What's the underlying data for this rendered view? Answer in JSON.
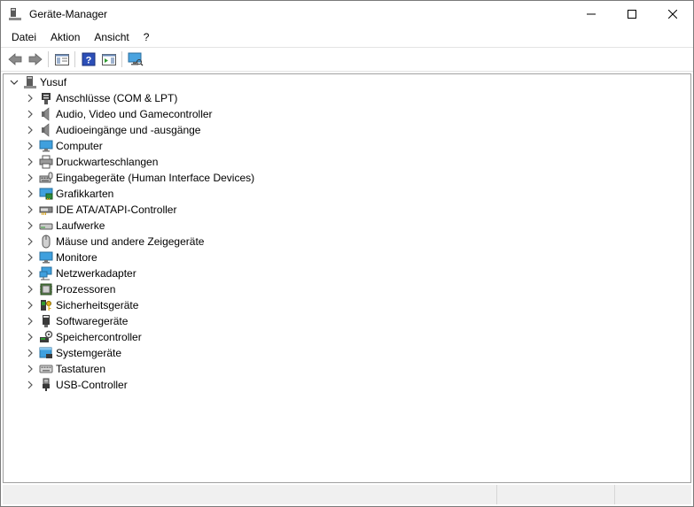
{
  "window": {
    "title": "Geräte-Manager"
  },
  "menu": [
    "Datei",
    "Aktion",
    "Ansicht",
    "?"
  ],
  "toolbar": [
    {
      "name": "back-button",
      "icon": "arrow-left-icon"
    },
    {
      "name": "forward-button",
      "icon": "arrow-right-icon"
    },
    {
      "name": "show-hide-console-tree-button",
      "icon": "console-tree-icon"
    },
    {
      "name": "help-button",
      "icon": "help-icon"
    },
    {
      "name": "action-pane-button",
      "icon": "action-pane-icon"
    },
    {
      "name": "scan-hardware-button",
      "icon": "monitor-scan-icon"
    }
  ],
  "tree": {
    "root": {
      "label": "Yusuf",
      "icon": "computer-tower-icon"
    },
    "categories": [
      {
        "label": "Anschlüsse (COM & LPT)",
        "icon": "port-icon"
      },
      {
        "label": "Audio, Video und Gamecontroller",
        "icon": "speaker-icon"
      },
      {
        "label": "Audioeingänge und -ausgänge",
        "icon": "speaker-icon"
      },
      {
        "label": "Computer",
        "icon": "monitor-icon"
      },
      {
        "label": "Druckwarteschlangen",
        "icon": "printer-icon"
      },
      {
        "label": "Eingabegeräte (Human Interface Devices)",
        "icon": "hid-icon"
      },
      {
        "label": "Grafikkarten",
        "icon": "display-adapter-icon"
      },
      {
        "label": "IDE ATA/ATAPI-Controller",
        "icon": "ide-controller-icon"
      },
      {
        "label": "Laufwerke",
        "icon": "drive-icon"
      },
      {
        "label": "Mäuse und andere Zeigegeräte",
        "icon": "mouse-icon"
      },
      {
        "label": "Monitore",
        "icon": "monitor-icon"
      },
      {
        "label": "Netzwerkadapter",
        "icon": "network-icon"
      },
      {
        "label": "Prozessoren",
        "icon": "processor-icon"
      },
      {
        "label": "Sicherheitsgeräte",
        "icon": "security-key-icon"
      },
      {
        "label": "Softwaregeräte",
        "icon": "software-device-icon"
      },
      {
        "label": "Speichercontroller",
        "icon": "storage-controller-icon"
      },
      {
        "label": "Systemgeräte",
        "icon": "system-device-icon"
      },
      {
        "label": "Tastaturen",
        "icon": "keyboard-icon"
      },
      {
        "label": "USB-Controller",
        "icon": "usb-icon"
      }
    ]
  }
}
